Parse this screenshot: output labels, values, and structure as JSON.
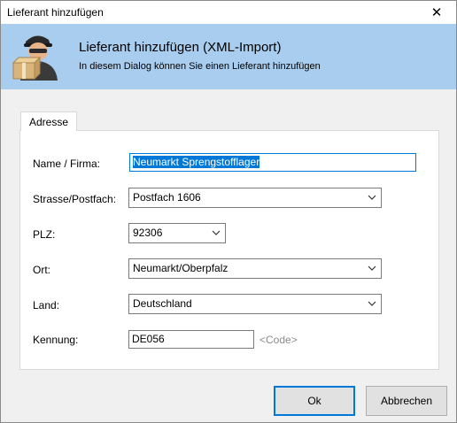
{
  "window": {
    "title": "Lieferant hinzufügen",
    "close_glyph": "✕"
  },
  "header": {
    "icon": "supplier-person-with-box-icon",
    "title": "Lieferant hinzufügen (XML-Import)",
    "subtitle": "In diesem Dialog können Sie einen Lieferant hinzufügen",
    "background": "#a8cdee"
  },
  "tabs": [
    {
      "label": "Adresse",
      "active": true
    }
  ],
  "form": {
    "name": {
      "label": "Name / Firma:",
      "value": "Neumarkt Sprengstofflager"
    },
    "street": {
      "label": "Strasse/Postfach:",
      "value": "Postfach 1606"
    },
    "plz": {
      "label": "PLZ:",
      "value": "92306"
    },
    "city": {
      "label": "Ort:",
      "value": "Neumarkt/Oberpfalz"
    },
    "country": {
      "label": "Land:",
      "value": "Deutschland"
    },
    "code": {
      "label": "Kennung:",
      "value": "DE056",
      "hint": "<Code>"
    }
  },
  "buttons": {
    "ok": "Ok",
    "cancel": "Abbrechen"
  },
  "colors": {
    "accent": "#0078d7",
    "header": "#a8cdee"
  }
}
